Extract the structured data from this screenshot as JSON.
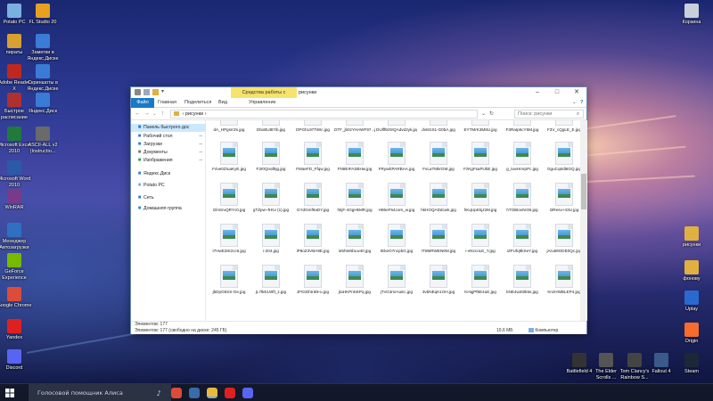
{
  "desktop": {
    "left_icons": [
      {
        "label": "Potato PC",
        "icon": "computer-icon",
        "color": "#7ab0e0"
      },
      {
        "label": "FL Studio 20",
        "icon": "fl-studio-icon",
        "color": "#e8a020"
      },
      {
        "label": "пираты",
        "icon": "folder-icon",
        "color": "#d8a030"
      },
      {
        "label": "Заметки в Яндекс.Диске",
        "icon": "yandex-disk-icon",
        "color": "#3a7bd5"
      },
      {
        "label": "Adobe Reader X",
        "icon": "adobe-reader-icon",
        "color": "#c0281e"
      },
      {
        "label": "Скриншоты в Яндекс.Диске",
        "icon": "yandex-disk-icon",
        "color": "#3a7bd5"
      },
      {
        "label": "Быстрое расписание",
        "icon": "app-icon",
        "color": "#b03030"
      },
      {
        "label": "Яндекс.Диск",
        "icon": "yandex-disk-icon",
        "color": "#3a7bd5"
      },
      {
        "label": "Microsoft Excel 2010",
        "icon": "excel-icon",
        "color": "#1f7a3c"
      },
      {
        "label": "ASCII-ALL v2 (Instructio...",
        "icon": "document-icon",
        "color": "#6a6a6a"
      },
      {
        "label": "Microsoft Word 2010",
        "icon": "word-icon",
        "color": "#2a5aa8"
      },
      {
        "label": "WinRAR",
        "icon": "winrar-icon",
        "color": "#7a3a8a"
      },
      {
        "label": "Менеджер Автозагрузки",
        "icon": "manager-icon",
        "color": "#3070c0"
      },
      {
        "label": "GeForce Experience",
        "icon": "nvidia-icon",
        "color": "#76b900"
      },
      {
        "label": "Google Chrome",
        "icon": "chrome-icon",
        "color": "#dd4b39"
      },
      {
        "label": "Yandex",
        "icon": "yandex-browser-icon",
        "color": "#e02020"
      },
      {
        "label": "Discord",
        "icon": "discord-icon",
        "color": "#5865f2"
      }
    ],
    "right_icons": [
      {
        "label": "Корзина",
        "icon": "recycle-bin-icon",
        "color": "#c8d0dc"
      },
      {
        "label": "рисунки",
        "icon": "folder-icon",
        "color": "#e0b040"
      },
      {
        "label": "фонову",
        "icon": "folder-icon",
        "color": "#e0b040"
      },
      {
        "label": "Uplay",
        "icon": "uplay-icon",
        "color": "#2a6ad0"
      },
      {
        "label": "Origin",
        "icon": "origin-icon",
        "color": "#f56c2d"
      }
    ],
    "bottom_icons": [
      {
        "label": "Battlefield 4",
        "icon": "game-icon",
        "color": "#333"
      },
      {
        "label": "The Elder Scrolls ...",
        "icon": "game-icon",
        "color": "#555"
      },
      {
        "label": "Tom Clancy's Rainbow S...",
        "icon": "game-icon",
        "color": "#444"
      },
      {
        "label": "Fallout 4",
        "icon": "game-icon",
        "color": "#3a5a8a"
      },
      {
        "label": "Steam",
        "icon": "steam-icon",
        "color": "#1b2838"
      }
    ]
  },
  "explorer": {
    "title": "рисунки",
    "context_tab": "Средства работы с рисунками",
    "tabs": [
      "Файл",
      "Главная",
      "Поделиться",
      "Вид",
      "Управление"
    ],
    "address": "рисунки",
    "search_placeholder": "Поиск: рисунки",
    "nav": [
      {
        "label": "Панель быстрого дос",
        "icon": "star-icon",
        "pinned": false,
        "selected": true
      },
      {
        "label": "Рабочий стол",
        "icon": "desktop-icon",
        "pinned": true
      },
      {
        "label": "Загрузки",
        "icon": "download-icon",
        "pinned": true
      },
      {
        "label": "Документы",
        "icon": "documents-icon",
        "pinned": true
      },
      {
        "label": "Изображения",
        "icon": "images-icon",
        "pinned": true
      },
      {
        "label": "Яндекс.Диск",
        "icon": "yandex-disk-icon",
        "pinned": false
      },
      {
        "label": "Potato PC",
        "icon": "computer-icon",
        "pinned": false
      },
      {
        "label": "Сеть",
        "icon": "network-icon",
        "pinned": false
      },
      {
        "label": "Домашняя группа",
        "icon": "homegroup-icon",
        "pinned": false
      }
    ],
    "rows": [
      [
        "dA_HPgsrrZs.jpg",
        "DbxBU8t7ib.jpg",
        "DPGhL97TiWc.jpg",
        "DTF_jb0zYHAWF97...jpg_large",
        "DUlff9z0rQAdvd2yk.jpg",
        "dvM1S1-G0bA.jpg",
        "EYTMrK3M8U.jpg",
        "F3Ratp6cY5M.jpg",
        "F3V_cQgLE_E.jpg"
      ],
      [
        "F4ve0ZIuaKyE.jpg",
        "F3r0Qnaf9jg.jpg",
        "FMaeFD_Ffqw.jpg",
        "FN8EIFASBHw.jpg",
        "FRywEPARBAA.jpg",
        "FvLaTMkrGM.jpg",
        "FzKgFsaPUbE.jpg",
        "g_ivwHmrpPc.jpg",
        "GguCq6dt8GQ.jpg"
      ],
      [
        "GlnSruQRYc0.jpg",
        "gTZpw~fHIU (1).jpg",
        "GYdGmf9aDY.jpg",
        "hkjF-4GgHkMR.jpg",
        "H86eF54com_w.jpg",
        "hkHOQADdcwk.jpg",
        "hKqUpKkjJ2M.jpg",
        "hTOiBovNr36.jpg",
        "I3Resv+43U.jpg"
      ],
      [
        "I7HwE3iK2cc6.jpg",
        "i-204.jpg",
        "iP8oZ3VBA9E.jpg",
        "ie5hWsbLw40.jpg",
        "IEkeO7ncpbG.jpg",
        "IT8MRWEN6M.jpg",
        "i-vNzcoLE_Y.jpg",
        "iZFUfq8kSeY.jpg",
        "jAru69ODE0Qc.jpg"
      ],
      [
        "jbDpO5SS-Ge.jpg",
        "jL7lkE1Wft_z.jpg",
        "JFtGDhtnk9-u.jpg",
        "jtaHKPnKEPq.jpg",
        "jTvG3mrAuEc.jpg",
        "3vbNEqK1OH.jpg",
        "KHqjPf8E4uE.jpg",
        "kNE4w2t0k5s.jpg",
        "KnzHWBLEP4.jpg"
      ]
    ],
    "items_label": "Элементов: 177",
    "status_left": "Элементов: 177 (свободно на диске: 245 ГБ)",
    "status_size": "10,6 МБ",
    "status_location": "Компьютер"
  },
  "taskbar": {
    "search_placeholder": "Голосовой помощник Алиса",
    "apps": [
      {
        "icon": "alice-mic-icon",
        "color": "#cfd3db"
      },
      {
        "icon": "chrome-icon",
        "color": "#dd4b39"
      },
      {
        "icon": "steam-icon",
        "color": "#3a6aa8"
      },
      {
        "icon": "explorer-icon",
        "color": "#e8b840"
      },
      {
        "icon": "yandex-browser-icon",
        "color": "#e02020"
      },
      {
        "icon": "discord-icon",
        "color": "#5865f2"
      }
    ]
  }
}
